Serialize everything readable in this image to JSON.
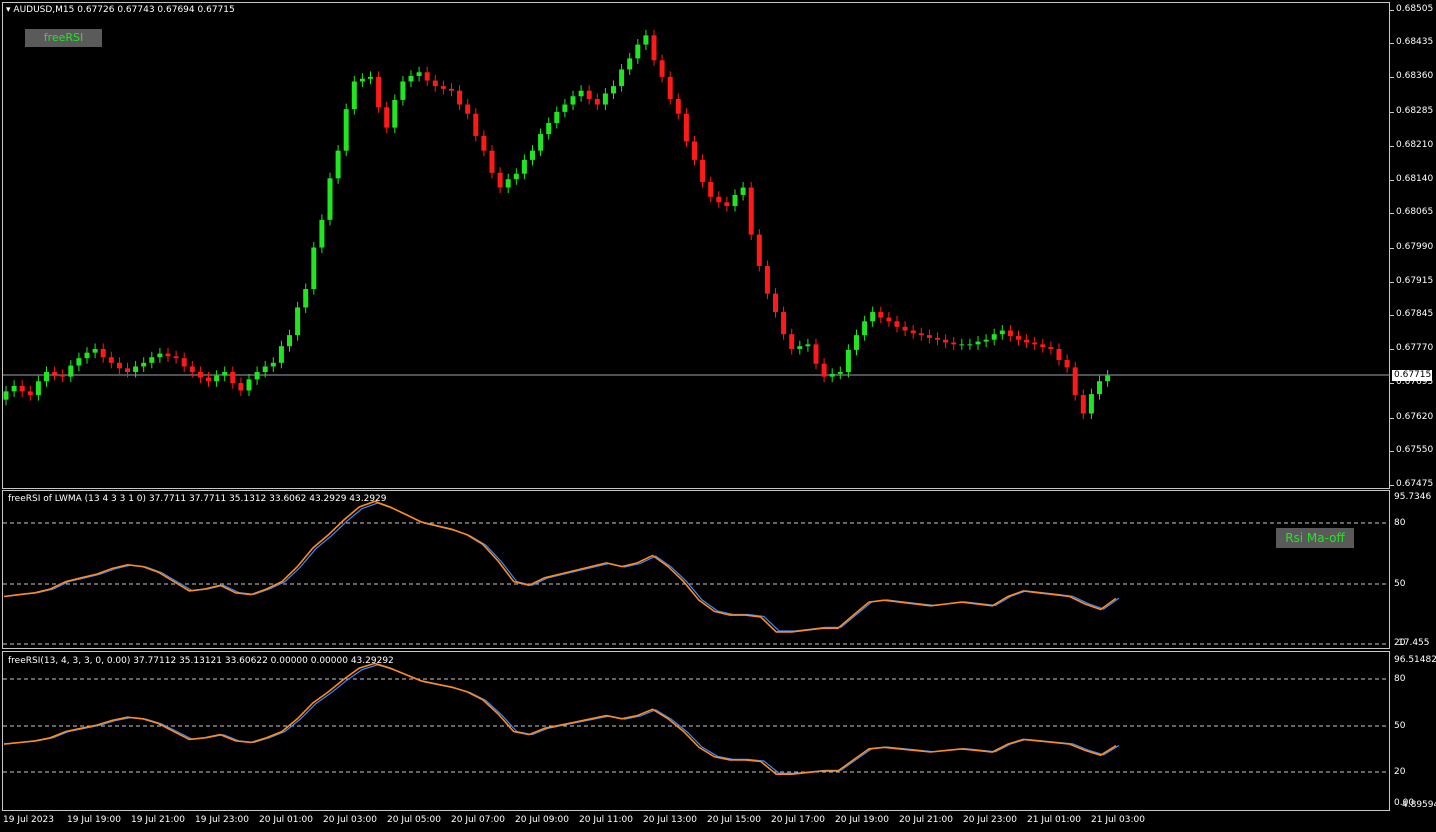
{
  "chart_header": {
    "symbol": "AUDUSD,M15",
    "ohlc": "0.67726 0.67743 0.67694 0.67715"
  },
  "buttons": {
    "freersi": "freeRSI",
    "rsi_ma_off": "Rsi Ma-off"
  },
  "main_pane": {
    "price_scale": [
      "0.68505",
      "0.68435",
      "0.68360",
      "0.68285",
      "0.68210",
      "0.68140",
      "0.68065",
      "0.67990",
      "0.67915",
      "0.67845",
      "0.67770",
      "0.67695",
      "0.67620",
      "0.67550",
      "0.67475"
    ],
    "current_price": "0.67715"
  },
  "indicator1": {
    "title": "freeRSI of LWMA (13 4 3 3 1 0) 37.7711 37.7711 35.1312 33.6062 43.2929 43.2929",
    "scale": [
      "95.7346",
      "80",
      "50",
      "20",
      "17.455"
    ]
  },
  "indicator2": {
    "title": "freeRSI(13, 4, 3, 3, 0, 0.00) 37.77112 35.13121 33.60622 0.00000 0.00000 43.29292",
    "scale": [
      "96.51482",
      "80",
      "50",
      "20",
      "0.00",
      "4.89594"
    ]
  },
  "time_axis": [
    "19 Jul 2023",
    "19 Jul 19:00",
    "19 Jul 21:00",
    "19 Jul 23:00",
    "20 Jul 01:00",
    "20 Jul 03:00",
    "20 Jul 05:00",
    "20 Jul 07:00",
    "20 Jul 09:00",
    "20 Jul 11:00",
    "20 Jul 13:00",
    "20 Jul 15:00",
    "20 Jul 17:00",
    "20 Jul 19:00",
    "20 Jul 21:00",
    "20 Jul 23:00",
    "21 Jul 01:00",
    "21 Jul 03:00"
  ],
  "colors": {
    "background": "#000000",
    "bull": "#22e522",
    "bear": "#ff1a1a",
    "rsi_orange": "#ff8c1a",
    "rsi_blue": "#3d8bff",
    "grid": "#c8c8c8"
  },
  "chart_data": {
    "type": "candlestick",
    "rsi_series": [
      44,
      45,
      46,
      48,
      52,
      54,
      56,
      59,
      61,
      60,
      57,
      52,
      47,
      48,
      50,
      46,
      45,
      48,
      52,
      60,
      70,
      77,
      85,
      92,
      95,
      92,
      88,
      84,
      82,
      80,
      77,
      72,
      63,
      52,
      50,
      54,
      56,
      58,
      60,
      62,
      60,
      62,
      66,
      60,
      52,
      42,
      36,
      34,
      34,
      33,
      25,
      25,
      26,
      27,
      27,
      34,
      41,
      42,
      41,
      40,
      39,
      40,
      41,
      40,
      39,
      44,
      47,
      46,
      45,
      44,
      40,
      37,
      43
    ]
  }
}
